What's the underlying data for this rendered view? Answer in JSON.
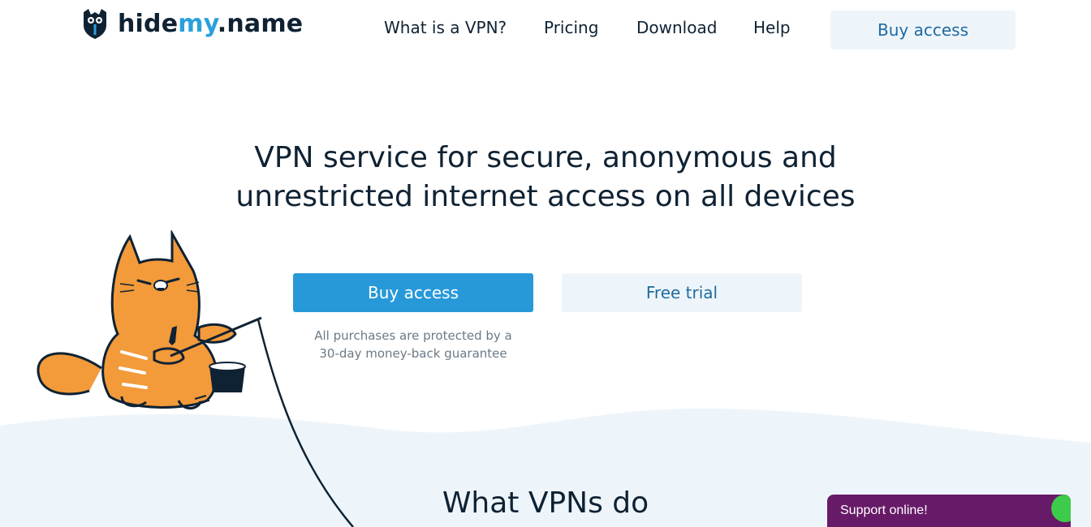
{
  "header": {
    "logo": {
      "hide": "hide",
      "my": "my",
      "name": ".name"
    },
    "nav": [
      "What is a VPN?",
      "Pricing",
      "Download",
      "Help"
    ],
    "buy_label": "Buy access"
  },
  "hero": {
    "title_line1": "VPN service for secure, anonymous and",
    "title_line2": "unrestricted internet access on all devices",
    "buy_label": "Buy access",
    "trial_label": "Free trial",
    "guarantee_line1": "All purchases are protected by a",
    "guarantee_line2": "30-day money-back guarantee"
  },
  "section": {
    "title": "What VPNs do"
  },
  "support": {
    "label": "Support online!"
  },
  "colors": {
    "accent": "#2799d9",
    "text": "#0f2233",
    "light_button": "#eef5fa",
    "wave": "#eef5fa",
    "support_bg": "#671a68",
    "support_dot": "#3ccb4b",
    "cat_orange": "#f39a3a"
  },
  "icons": {
    "logo": "shield-owl-icon",
    "illustration": "fishing-cat-illustration"
  }
}
